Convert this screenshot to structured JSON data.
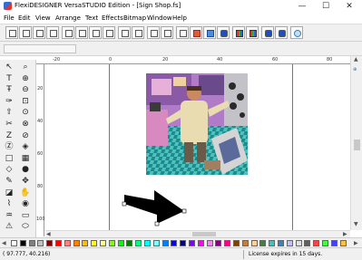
{
  "window": {
    "title": "FlexiDESIGNER VersaSTUDIO Edition - [Sign Shop.fs]",
    "minimize_glyph": "—",
    "maximize_glyph": "☐",
    "close_glyph": "✕",
    "app_icon": "flexi-app-icon"
  },
  "menu": {
    "items": [
      "File",
      "Edit",
      "View",
      "Arrange",
      "Text",
      "Effects",
      "Bitmap",
      "Window",
      "Help"
    ]
  },
  "ruler": {
    "h_ticks": [
      "-20",
      "0",
      "20",
      "40",
      "60",
      "80"
    ],
    "v_ticks": [
      "20",
      "40",
      "60",
      "80",
      "100"
    ]
  },
  "toolbox": {
    "tools": [
      {
        "icon": "select-arrow-icon",
        "glyph": "↖"
      },
      {
        "icon": "zoom-icon",
        "glyph": "⌕"
      },
      {
        "icon": "text-icon",
        "glyph": "T"
      },
      {
        "icon": "zoom-in-icon",
        "glyph": "⊕"
      },
      {
        "icon": "text-path-icon",
        "glyph": "Ŧ"
      },
      {
        "icon": "zoom-out-icon",
        "glyph": "⊖"
      },
      {
        "icon": "pen-icon",
        "glyph": "✑"
      },
      {
        "icon": "zoom-fit-icon",
        "glyph": "⊡"
      },
      {
        "icon": "shape-up-icon",
        "glyph": "⇧"
      },
      {
        "icon": "zoom-page-icon",
        "glyph": "⊙"
      },
      {
        "icon": "scissors-icon",
        "glyph": "✂"
      },
      {
        "icon": "zoom-select-icon",
        "glyph": "⊗"
      },
      {
        "icon": "distort-icon",
        "glyph": "Z"
      },
      {
        "icon": "color-dropper-icon",
        "glyph": "⊘"
      },
      {
        "icon": "weld-icon",
        "glyph": "Ⓩ"
      },
      {
        "icon": "fill-icon",
        "glyph": "◈"
      },
      {
        "icon": "rectangle-icon",
        "glyph": "□"
      },
      {
        "icon": "grid-icon",
        "glyph": "▦"
      },
      {
        "icon": "shape-icon",
        "glyph": "◇"
      },
      {
        "icon": "color-icon",
        "glyph": "●"
      },
      {
        "icon": "eyedropper-icon",
        "glyph": "✎"
      },
      {
        "icon": "move-icon",
        "glyph": "✥"
      },
      {
        "icon": "eraser-icon",
        "glyph": "◪"
      },
      {
        "icon": "hand-icon",
        "glyph": "✋"
      },
      {
        "icon": "brush-icon",
        "glyph": "⌇"
      },
      {
        "icon": "circle-icon",
        "glyph": "◉"
      },
      {
        "icon": "paint-bucket-icon",
        "glyph": "♒"
      },
      {
        "icon": "panel-icon",
        "glyph": "▭"
      },
      {
        "icon": "warning-icon",
        "glyph": "⚠"
      },
      {
        "icon": "ellipse-icon",
        "glyph": "⬭"
      }
    ]
  },
  "palette": {
    "colors": [
      "#ffffff",
      "#000000",
      "#808080",
      "#c0c0c0",
      "#800000",
      "#ff0000",
      "#ff8080",
      "#ff8000",
      "#ffbf00",
      "#ffff00",
      "#ffff80",
      "#80ff00",
      "#00ff00",
      "#008000",
      "#00ff80",
      "#00ffff",
      "#80ffff",
      "#0080ff",
      "#0000ff",
      "#000080",
      "#8000ff",
      "#ff00ff",
      "#ff80ff",
      "#800080",
      "#ff0080",
      "#804000",
      "#c08040",
      "#ffd0a0",
      "#408040",
      "#40c0c0",
      "#4080c0",
      "#c0c0ff",
      "#e0e0e0",
      "#606060",
      "#ff4040",
      "#40ff40",
      "#4040ff",
      "#ffc040"
    ]
  },
  "status": {
    "coords": "( 97.777,    40.216)",
    "license": "License expires in 15 days."
  }
}
